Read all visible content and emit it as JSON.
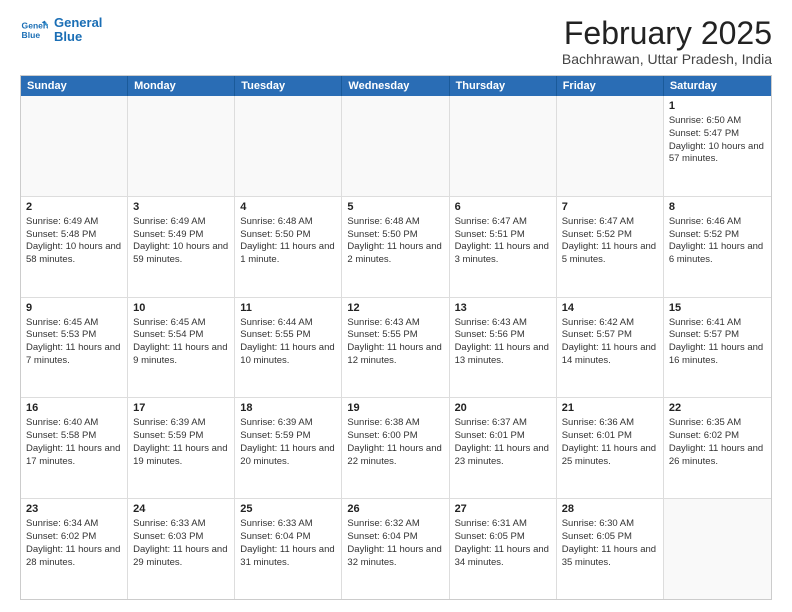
{
  "header": {
    "logo_line1": "General",
    "logo_line2": "Blue",
    "title": "February 2025",
    "subtitle": "Bachhrawan, Uttar Pradesh, India"
  },
  "weekdays": [
    "Sunday",
    "Monday",
    "Tuesday",
    "Wednesday",
    "Thursday",
    "Friday",
    "Saturday"
  ],
  "rows": [
    [
      {
        "day": "",
        "text": "",
        "empty": true
      },
      {
        "day": "",
        "text": "",
        "empty": true
      },
      {
        "day": "",
        "text": "",
        "empty": true
      },
      {
        "day": "",
        "text": "",
        "empty": true
      },
      {
        "day": "",
        "text": "",
        "empty": true
      },
      {
        "day": "",
        "text": "",
        "empty": true
      },
      {
        "day": "1",
        "text": "Sunrise: 6:50 AM\nSunset: 5:47 PM\nDaylight: 10 hours and 57 minutes.",
        "empty": false
      }
    ],
    [
      {
        "day": "2",
        "text": "Sunrise: 6:49 AM\nSunset: 5:48 PM\nDaylight: 10 hours and 58 minutes.",
        "empty": false
      },
      {
        "day": "3",
        "text": "Sunrise: 6:49 AM\nSunset: 5:49 PM\nDaylight: 10 hours and 59 minutes.",
        "empty": false
      },
      {
        "day": "4",
        "text": "Sunrise: 6:48 AM\nSunset: 5:50 PM\nDaylight: 11 hours and 1 minute.",
        "empty": false
      },
      {
        "day": "5",
        "text": "Sunrise: 6:48 AM\nSunset: 5:50 PM\nDaylight: 11 hours and 2 minutes.",
        "empty": false
      },
      {
        "day": "6",
        "text": "Sunrise: 6:47 AM\nSunset: 5:51 PM\nDaylight: 11 hours and 3 minutes.",
        "empty": false
      },
      {
        "day": "7",
        "text": "Sunrise: 6:47 AM\nSunset: 5:52 PM\nDaylight: 11 hours and 5 minutes.",
        "empty": false
      },
      {
        "day": "8",
        "text": "Sunrise: 6:46 AM\nSunset: 5:52 PM\nDaylight: 11 hours and 6 minutes.",
        "empty": false
      }
    ],
    [
      {
        "day": "9",
        "text": "Sunrise: 6:45 AM\nSunset: 5:53 PM\nDaylight: 11 hours and 7 minutes.",
        "empty": false
      },
      {
        "day": "10",
        "text": "Sunrise: 6:45 AM\nSunset: 5:54 PM\nDaylight: 11 hours and 9 minutes.",
        "empty": false
      },
      {
        "day": "11",
        "text": "Sunrise: 6:44 AM\nSunset: 5:55 PM\nDaylight: 11 hours and 10 minutes.",
        "empty": false
      },
      {
        "day": "12",
        "text": "Sunrise: 6:43 AM\nSunset: 5:55 PM\nDaylight: 11 hours and 12 minutes.",
        "empty": false
      },
      {
        "day": "13",
        "text": "Sunrise: 6:43 AM\nSunset: 5:56 PM\nDaylight: 11 hours and 13 minutes.",
        "empty": false
      },
      {
        "day": "14",
        "text": "Sunrise: 6:42 AM\nSunset: 5:57 PM\nDaylight: 11 hours and 14 minutes.",
        "empty": false
      },
      {
        "day": "15",
        "text": "Sunrise: 6:41 AM\nSunset: 5:57 PM\nDaylight: 11 hours and 16 minutes.",
        "empty": false
      }
    ],
    [
      {
        "day": "16",
        "text": "Sunrise: 6:40 AM\nSunset: 5:58 PM\nDaylight: 11 hours and 17 minutes.",
        "empty": false
      },
      {
        "day": "17",
        "text": "Sunrise: 6:39 AM\nSunset: 5:59 PM\nDaylight: 11 hours and 19 minutes.",
        "empty": false
      },
      {
        "day": "18",
        "text": "Sunrise: 6:39 AM\nSunset: 5:59 PM\nDaylight: 11 hours and 20 minutes.",
        "empty": false
      },
      {
        "day": "19",
        "text": "Sunrise: 6:38 AM\nSunset: 6:00 PM\nDaylight: 11 hours and 22 minutes.",
        "empty": false
      },
      {
        "day": "20",
        "text": "Sunrise: 6:37 AM\nSunset: 6:01 PM\nDaylight: 11 hours and 23 minutes.",
        "empty": false
      },
      {
        "day": "21",
        "text": "Sunrise: 6:36 AM\nSunset: 6:01 PM\nDaylight: 11 hours and 25 minutes.",
        "empty": false
      },
      {
        "day": "22",
        "text": "Sunrise: 6:35 AM\nSunset: 6:02 PM\nDaylight: 11 hours and 26 minutes.",
        "empty": false
      }
    ],
    [
      {
        "day": "23",
        "text": "Sunrise: 6:34 AM\nSunset: 6:02 PM\nDaylight: 11 hours and 28 minutes.",
        "empty": false
      },
      {
        "day": "24",
        "text": "Sunrise: 6:33 AM\nSunset: 6:03 PM\nDaylight: 11 hours and 29 minutes.",
        "empty": false
      },
      {
        "day": "25",
        "text": "Sunrise: 6:33 AM\nSunset: 6:04 PM\nDaylight: 11 hours and 31 minutes.",
        "empty": false
      },
      {
        "day": "26",
        "text": "Sunrise: 6:32 AM\nSunset: 6:04 PM\nDaylight: 11 hours and 32 minutes.",
        "empty": false
      },
      {
        "day": "27",
        "text": "Sunrise: 6:31 AM\nSunset: 6:05 PM\nDaylight: 11 hours and 34 minutes.",
        "empty": false
      },
      {
        "day": "28",
        "text": "Sunrise: 6:30 AM\nSunset: 6:05 PM\nDaylight: 11 hours and 35 minutes.",
        "empty": false
      },
      {
        "day": "",
        "text": "",
        "empty": true
      }
    ]
  ]
}
